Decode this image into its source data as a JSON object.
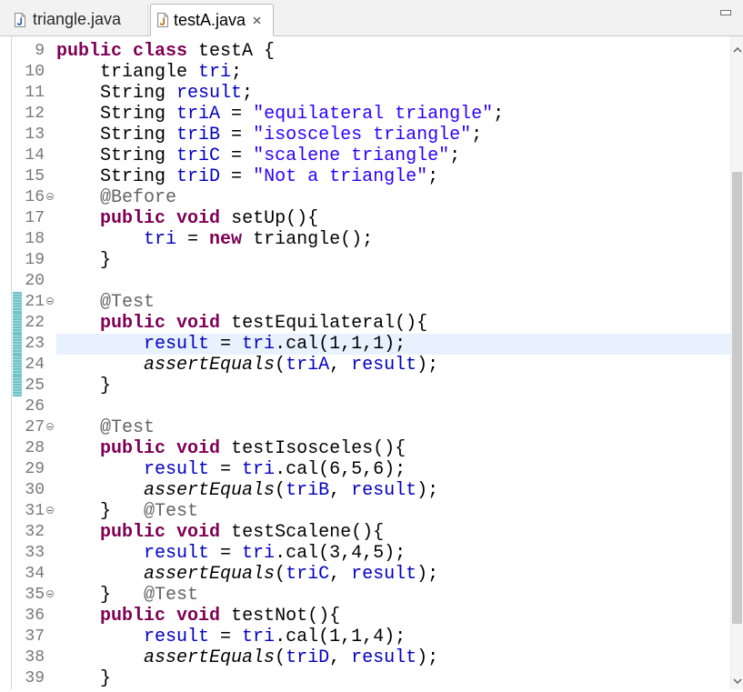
{
  "tabs": [
    {
      "label": "triangle.java",
      "icon": "java-file-icon",
      "active": false
    },
    {
      "label": "testA.java",
      "icon": "java-file-icon",
      "active": true,
      "close_icon": "close-icon"
    }
  ],
  "window": {
    "minimize_icon": "minimize-icon"
  },
  "colors": {
    "keyword": "#7f0055",
    "string": "#2a00ff",
    "field": "#0000c0",
    "annotation": "#646464",
    "line_number": "#787878",
    "current_line_bg": "#e8f2fe",
    "quick_diff": "#7cc9cd"
  },
  "scrollbar": {
    "offset_fraction": 0.18,
    "visible_fraction": 0.74
  },
  "editor": {
    "current_line": 23,
    "lines": [
      {
        "n": 9,
        "tokens": [
          [
            "kw",
            "public"
          ],
          [
            "txt",
            " "
          ],
          [
            "kw",
            "class"
          ],
          [
            "txt",
            " testA {"
          ]
        ]
      },
      {
        "n": 10,
        "tokens": [
          [
            "txt",
            "    triangle "
          ],
          [
            "fld",
            "tri"
          ],
          [
            "txt",
            ";"
          ]
        ]
      },
      {
        "n": 11,
        "tokens": [
          [
            "txt",
            "    String "
          ],
          [
            "fld",
            "result"
          ],
          [
            "txt",
            ";"
          ]
        ]
      },
      {
        "n": 12,
        "tokens": [
          [
            "txt",
            "    String "
          ],
          [
            "fld",
            "triA"
          ],
          [
            "txt",
            " = "
          ],
          [
            "str",
            "\"equilateral triangle\""
          ],
          [
            "txt",
            ";"
          ]
        ]
      },
      {
        "n": 13,
        "tokens": [
          [
            "txt",
            "    String "
          ],
          [
            "fld",
            "triB"
          ],
          [
            "txt",
            " = "
          ],
          [
            "str",
            "\"isosceles triangle\""
          ],
          [
            "txt",
            ";"
          ]
        ]
      },
      {
        "n": 14,
        "tokens": [
          [
            "txt",
            "    String "
          ],
          [
            "fld",
            "triC"
          ],
          [
            "txt",
            " = "
          ],
          [
            "str",
            "\"scalene triangle\""
          ],
          [
            "txt",
            ";"
          ]
        ]
      },
      {
        "n": 15,
        "tokens": [
          [
            "txt",
            "    String "
          ],
          [
            "fld",
            "triD"
          ],
          [
            "txt",
            " = "
          ],
          [
            "str",
            "\"Not a triangle\""
          ],
          [
            "txt",
            ";"
          ]
        ]
      },
      {
        "n": 16,
        "fold": true,
        "tokens": [
          [
            "txt",
            "    "
          ],
          [
            "ann",
            "@Before"
          ]
        ]
      },
      {
        "n": 17,
        "tokens": [
          [
            "txt",
            "    "
          ],
          [
            "kw",
            "public"
          ],
          [
            "txt",
            " "
          ],
          [
            "kw",
            "void"
          ],
          [
            "txt",
            " setUp(){"
          ]
        ]
      },
      {
        "n": 18,
        "tokens": [
          [
            "txt",
            "        "
          ],
          [
            "fld",
            "tri"
          ],
          [
            "txt",
            " = "
          ],
          [
            "kw",
            "new"
          ],
          [
            "txt",
            " triangle();"
          ]
        ]
      },
      {
        "n": 19,
        "tokens": [
          [
            "txt",
            "    }"
          ]
        ]
      },
      {
        "n": 20,
        "tokens": []
      },
      {
        "n": 21,
        "fold": true,
        "changed": true,
        "tokens": [
          [
            "txt",
            "    "
          ],
          [
            "ann",
            "@Test"
          ]
        ]
      },
      {
        "n": 22,
        "changed": true,
        "tokens": [
          [
            "txt",
            "    "
          ],
          [
            "kw",
            "public"
          ],
          [
            "txt",
            " "
          ],
          [
            "kw",
            "void"
          ],
          [
            "txt",
            " testEquilateral(){"
          ]
        ]
      },
      {
        "n": 23,
        "changed": true,
        "tokens": [
          [
            "txt",
            "        "
          ],
          [
            "fld",
            "result"
          ],
          [
            "txt",
            " = "
          ],
          [
            "fld",
            "tri"
          ],
          [
            "txt",
            ".cal(1,1,1);"
          ]
        ]
      },
      {
        "n": 24,
        "changed": true,
        "tokens": [
          [
            "txt",
            "        "
          ],
          [
            "stat",
            "assertEquals"
          ],
          [
            "txt",
            "("
          ],
          [
            "fld",
            "triA"
          ],
          [
            "txt",
            ", "
          ],
          [
            "fld",
            "result"
          ],
          [
            "txt",
            ");"
          ]
        ]
      },
      {
        "n": 25,
        "changed": true,
        "tokens": [
          [
            "txt",
            "    }"
          ]
        ]
      },
      {
        "n": 26,
        "tokens": []
      },
      {
        "n": 27,
        "fold": true,
        "tokens": [
          [
            "txt",
            "    "
          ],
          [
            "ann",
            "@Test"
          ]
        ]
      },
      {
        "n": 28,
        "tokens": [
          [
            "txt",
            "    "
          ],
          [
            "kw",
            "public"
          ],
          [
            "txt",
            " "
          ],
          [
            "kw",
            "void"
          ],
          [
            "txt",
            " testIsosceles(){"
          ]
        ]
      },
      {
        "n": 29,
        "tokens": [
          [
            "txt",
            "        "
          ],
          [
            "fld",
            "result"
          ],
          [
            "txt",
            " = "
          ],
          [
            "fld",
            "tri"
          ],
          [
            "txt",
            ".cal(6,5,6);"
          ]
        ]
      },
      {
        "n": 30,
        "tokens": [
          [
            "txt",
            "        "
          ],
          [
            "stat",
            "assertEquals"
          ],
          [
            "txt",
            "("
          ],
          [
            "fld",
            "triB"
          ],
          [
            "txt",
            ", "
          ],
          [
            "fld",
            "result"
          ],
          [
            "txt",
            ");"
          ]
        ]
      },
      {
        "n": 31,
        "fold": true,
        "tokens": [
          [
            "txt",
            "    }   "
          ],
          [
            "ann",
            "@Test"
          ]
        ]
      },
      {
        "n": 32,
        "tokens": [
          [
            "txt",
            "    "
          ],
          [
            "kw",
            "public"
          ],
          [
            "txt",
            " "
          ],
          [
            "kw",
            "void"
          ],
          [
            "txt",
            " testScalene(){"
          ]
        ]
      },
      {
        "n": 33,
        "tokens": [
          [
            "txt",
            "        "
          ],
          [
            "fld",
            "result"
          ],
          [
            "txt",
            " = "
          ],
          [
            "fld",
            "tri"
          ],
          [
            "txt",
            ".cal(3,4,5);"
          ]
        ]
      },
      {
        "n": 34,
        "tokens": [
          [
            "txt",
            "        "
          ],
          [
            "stat",
            "assertEquals"
          ],
          [
            "txt",
            "("
          ],
          [
            "fld",
            "triC"
          ],
          [
            "txt",
            ", "
          ],
          [
            "fld",
            "result"
          ],
          [
            "txt",
            ");"
          ]
        ]
      },
      {
        "n": 35,
        "fold": true,
        "tokens": [
          [
            "txt",
            "    }   "
          ],
          [
            "ann",
            "@Test"
          ]
        ]
      },
      {
        "n": 36,
        "tokens": [
          [
            "txt",
            "    "
          ],
          [
            "kw",
            "public"
          ],
          [
            "txt",
            " "
          ],
          [
            "kw",
            "void"
          ],
          [
            "txt",
            " testNot(){"
          ]
        ]
      },
      {
        "n": 37,
        "tokens": [
          [
            "txt",
            "        "
          ],
          [
            "fld",
            "result"
          ],
          [
            "txt",
            " = "
          ],
          [
            "fld",
            "tri"
          ],
          [
            "txt",
            ".cal(1,1,4);"
          ]
        ]
      },
      {
        "n": 38,
        "tokens": [
          [
            "txt",
            "        "
          ],
          [
            "stat",
            "assertEquals"
          ],
          [
            "txt",
            "("
          ],
          [
            "fld",
            "triD"
          ],
          [
            "txt",
            ", "
          ],
          [
            "fld",
            "result"
          ],
          [
            "txt",
            ");"
          ]
        ]
      },
      {
        "n": 39,
        "tokens": [
          [
            "txt",
            "    }"
          ]
        ]
      }
    ]
  }
}
